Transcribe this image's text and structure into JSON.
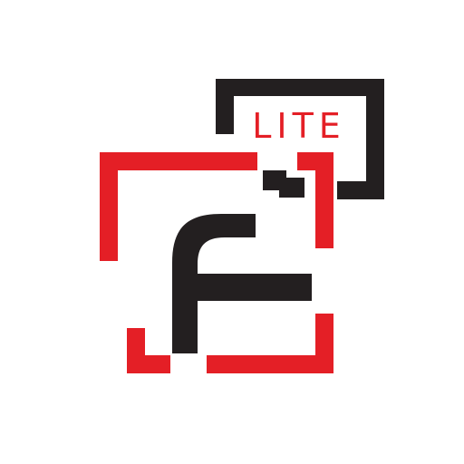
{
  "logo": {
    "badge_text": "LITE",
    "letter": "F",
    "colors": {
      "background": "#ffffff",
      "red": "#e41f26",
      "black": "#231f20"
    }
  }
}
